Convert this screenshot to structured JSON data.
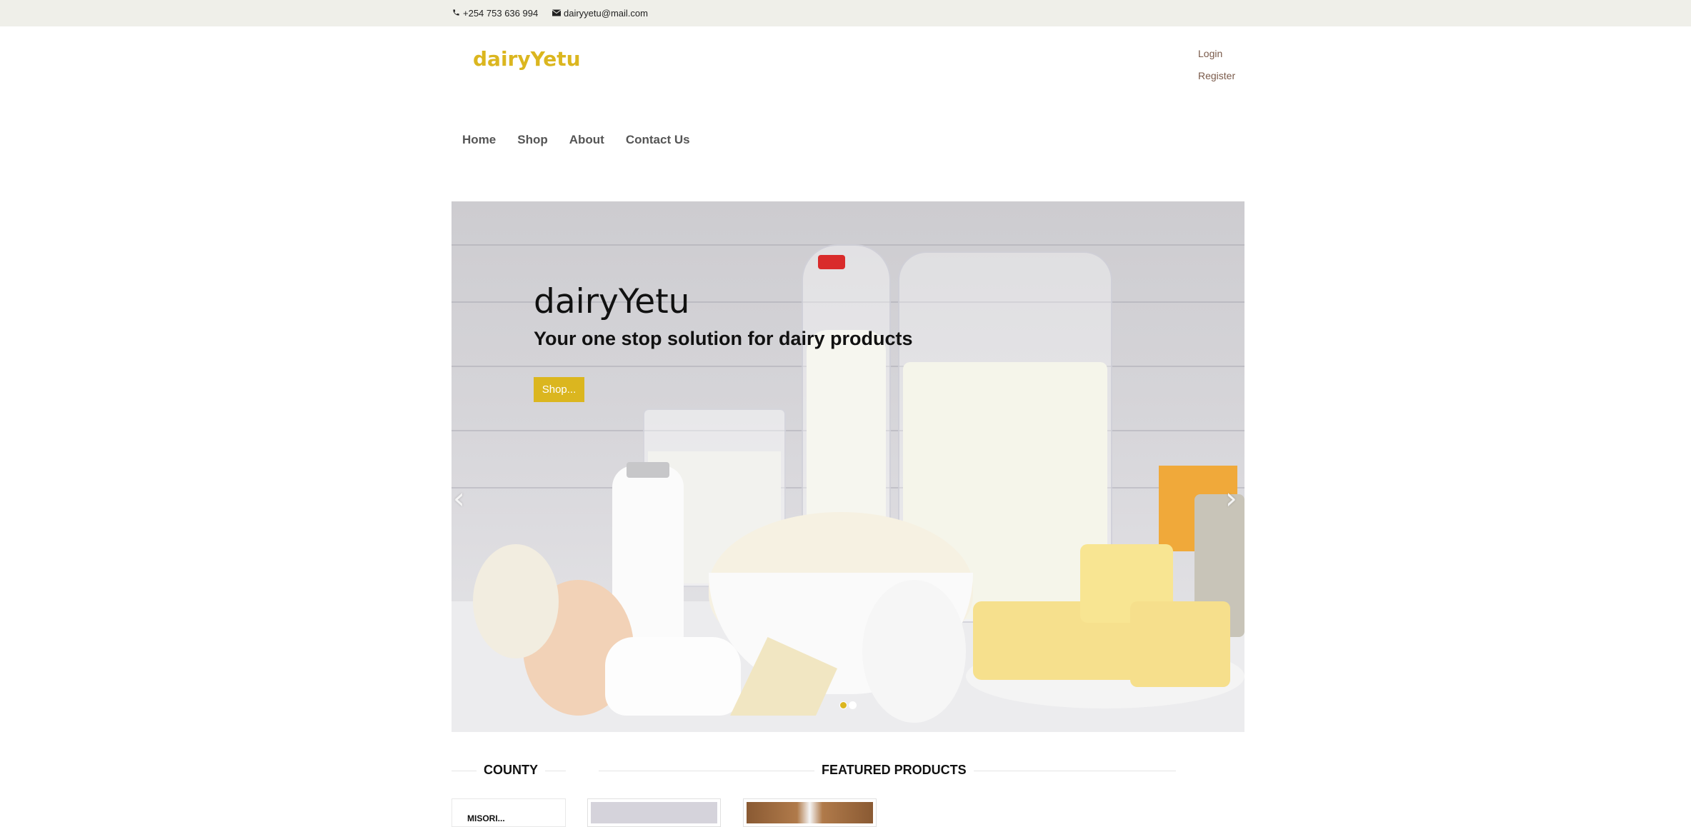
{
  "topbar": {
    "phone_icon": "phone-icon",
    "phone": "+254 753 636 994",
    "email_icon": "envelope-icon",
    "email": "dairyyetu@mail.com"
  },
  "brand": {
    "name": "dairyYetu",
    "color": "#dbb61f"
  },
  "auth": {
    "login": "Login",
    "register": "Register"
  },
  "nav": {
    "items": [
      "Home",
      "Shop",
      "About",
      "Contact Us"
    ]
  },
  "hero": {
    "title": "dairyYetu",
    "subtitle": "Your one stop solution for dairy products",
    "button": "Shop...",
    "prev_icon": "chevron-left-icon",
    "next_icon": "chevron-right-icon",
    "slides_total": 2,
    "active_slide": 1
  },
  "sections": {
    "county": "COUNTY",
    "featured": "FEATURED PRODUCTS"
  },
  "county_list": [
    "MISORI..."
  ],
  "colors": {
    "accent": "#dbb61f",
    "topbar_bg": "#efefe9"
  }
}
